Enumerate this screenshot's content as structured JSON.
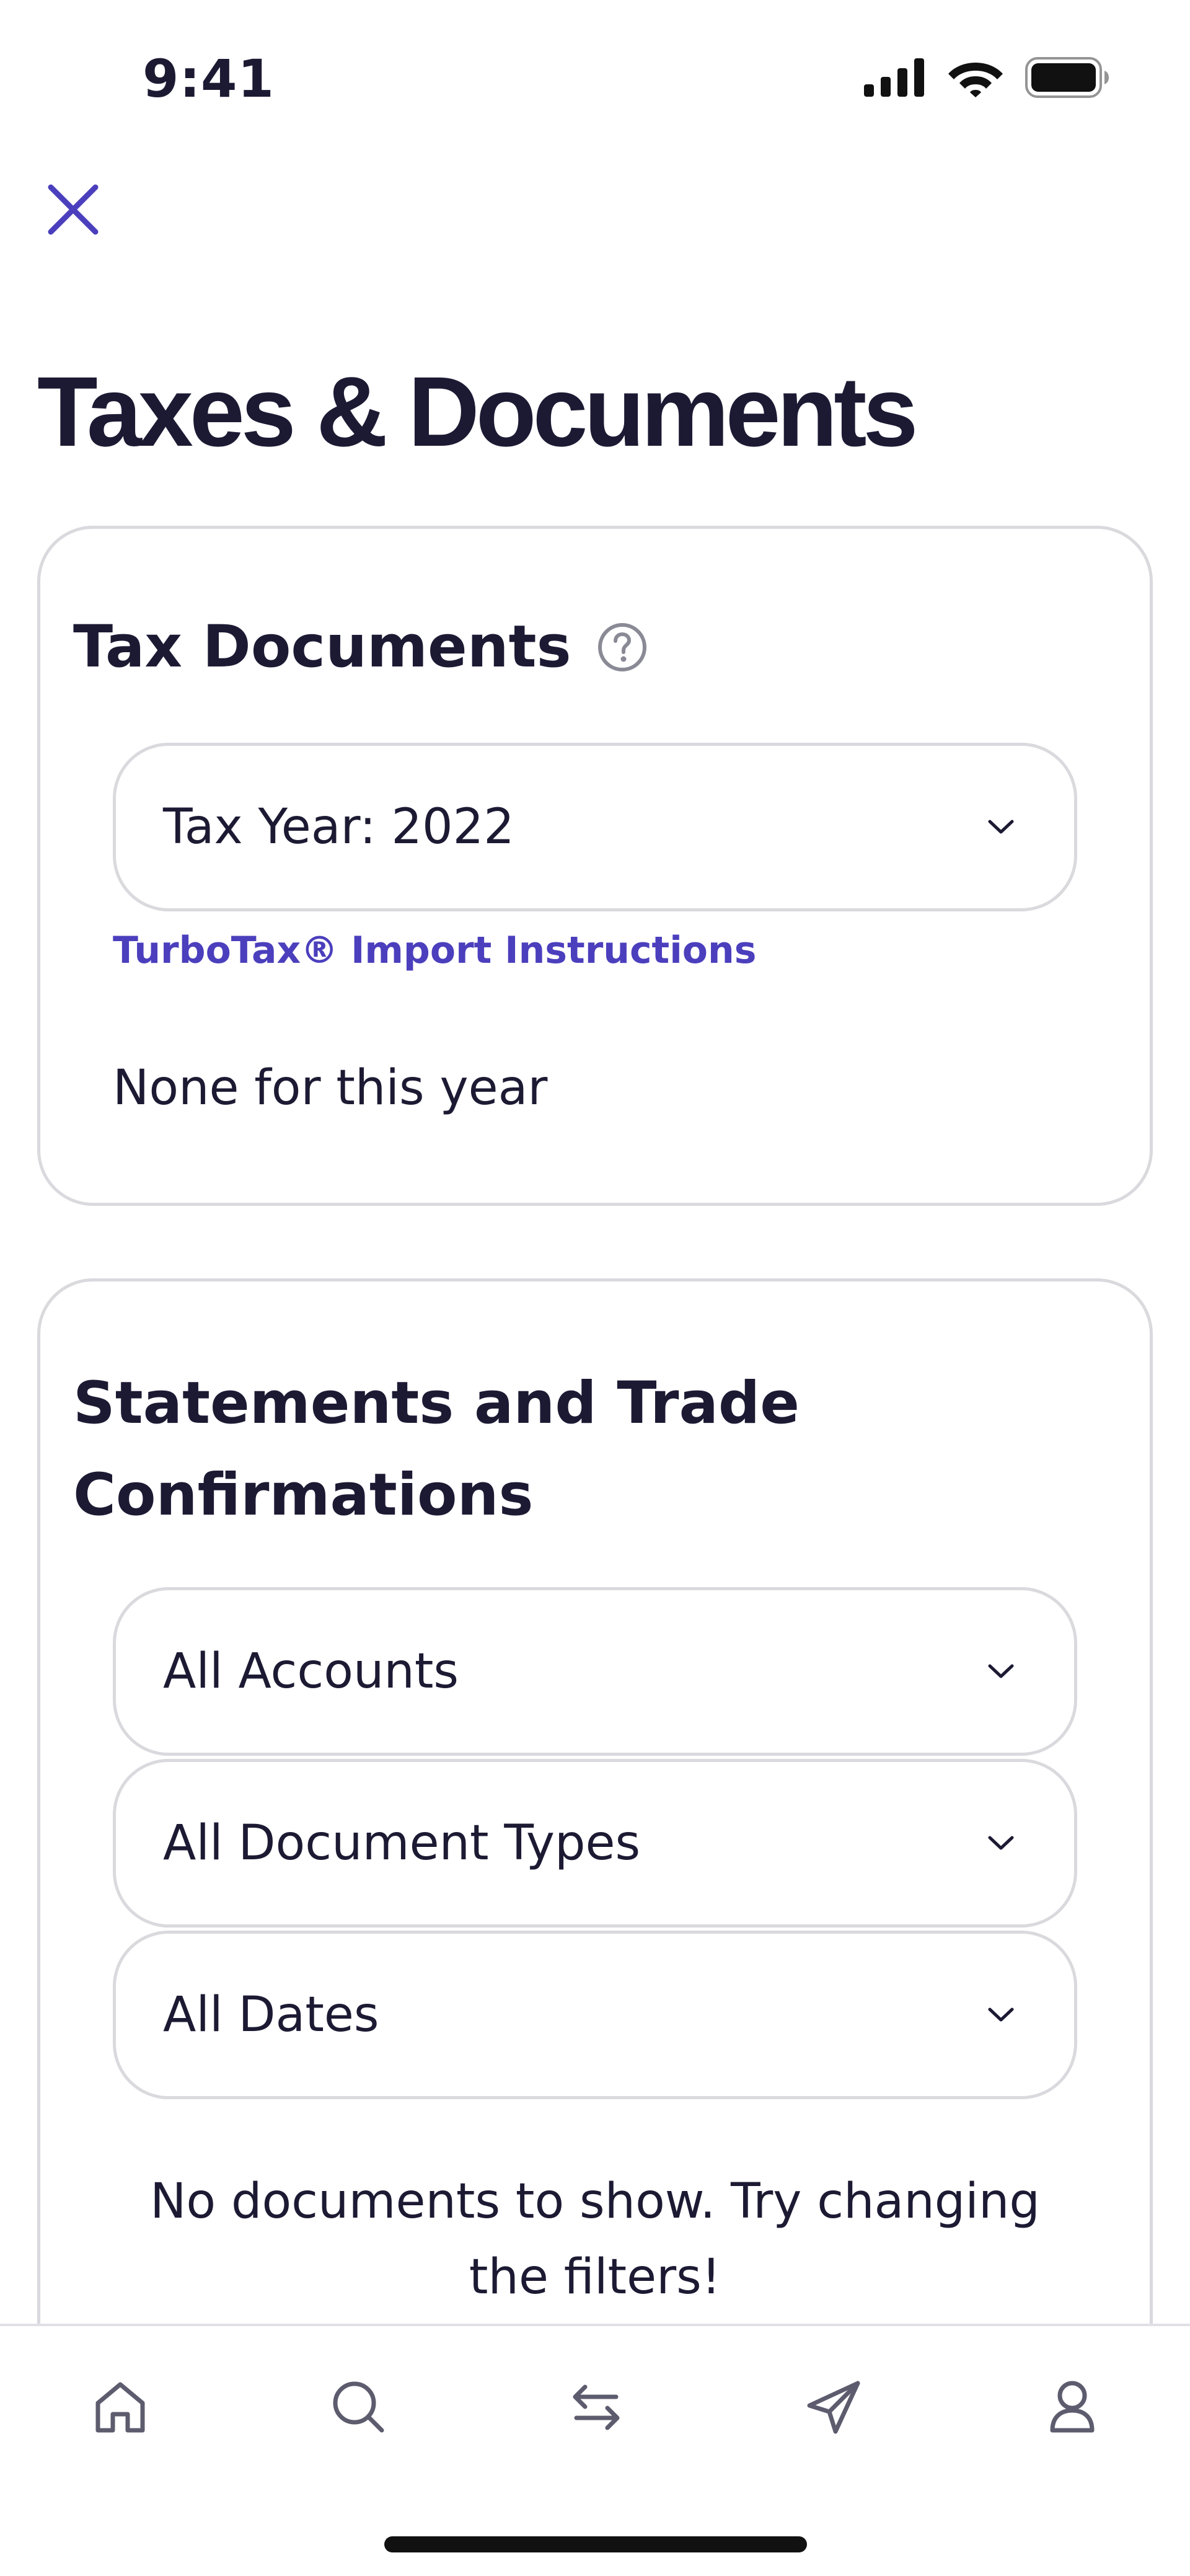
{
  "status": {
    "time": "9:41"
  },
  "header": {
    "title": "Taxes & Documents"
  },
  "tax_documents": {
    "heading": "Tax Documents",
    "tax_year_select": "Tax Year: 2022",
    "import_link": "TurboTax® Import Instructions",
    "empty_message": "None for this year"
  },
  "statements": {
    "heading": "Statements and Trade Confirmations",
    "filters": {
      "accounts": "All Accounts",
      "document_types": "All Document Types",
      "dates": "All Dates"
    },
    "empty_message": "No documents to show. Try changing the filters!"
  },
  "tab_bar": {
    "icons": [
      "home-icon",
      "search-icon",
      "transfer-icon",
      "send-icon",
      "profile-icon"
    ]
  },
  "colors": {
    "accent": "#4b3fbd",
    "text": "#1c1a33",
    "border": "#d9d9de",
    "icon_gray": "#5c5c6e"
  }
}
